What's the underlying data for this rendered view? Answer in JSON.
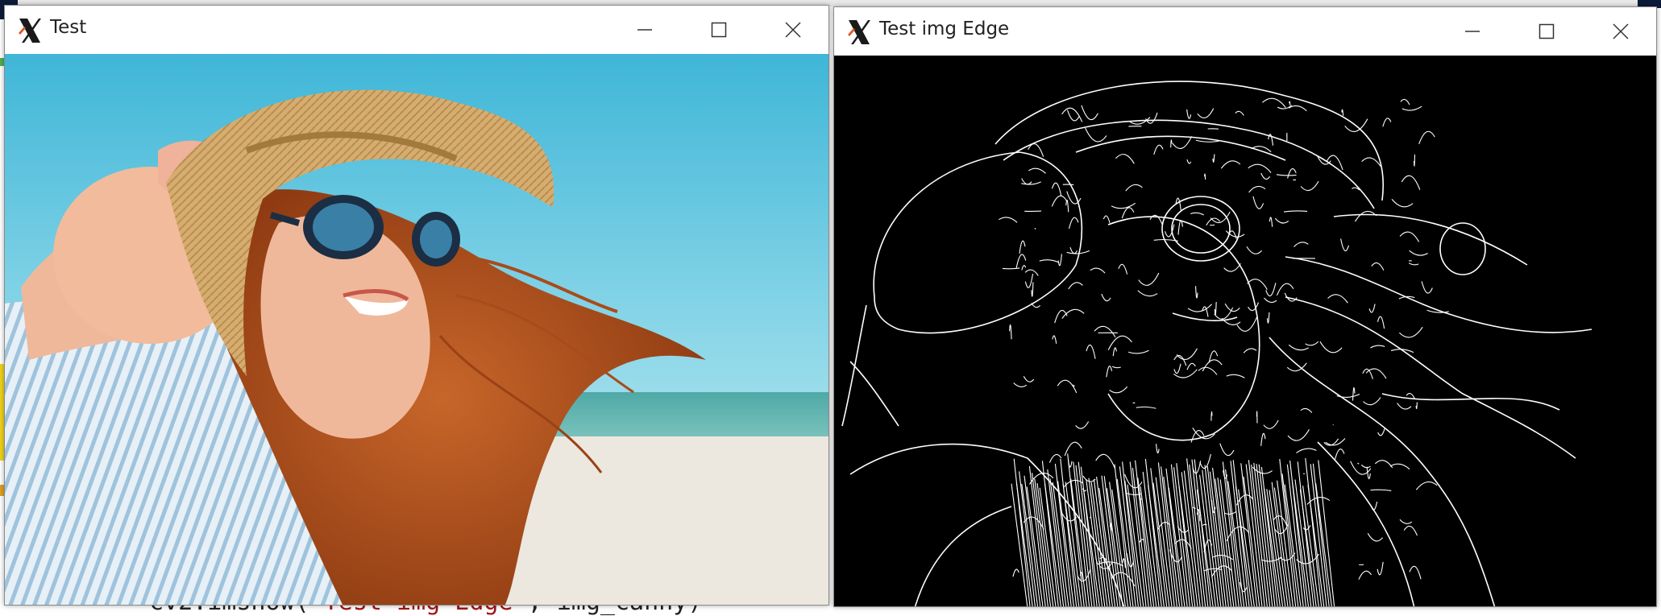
{
  "windows": [
    {
      "title": "Test",
      "content": "photo"
    },
    {
      "title": "Test img Edge",
      "content": "edges"
    }
  ],
  "background_code": {
    "prefix": "cv2.imshow(",
    "string": "\"Test img Edge\"",
    "suffix": ", img_canny)"
  },
  "colors": {
    "sky": "#5ec6e0",
    "hat": "#d2a86a",
    "hair": "#b5541f",
    "skin": "#f0b89a",
    "shirt": "#bcd6e8",
    "sand": "#ece7df",
    "edge_bg": "#000000",
    "edge_line": "#ffffff"
  },
  "icons": [
    "x-app-icon",
    "minimize-icon",
    "maximize-icon",
    "close-icon"
  ]
}
